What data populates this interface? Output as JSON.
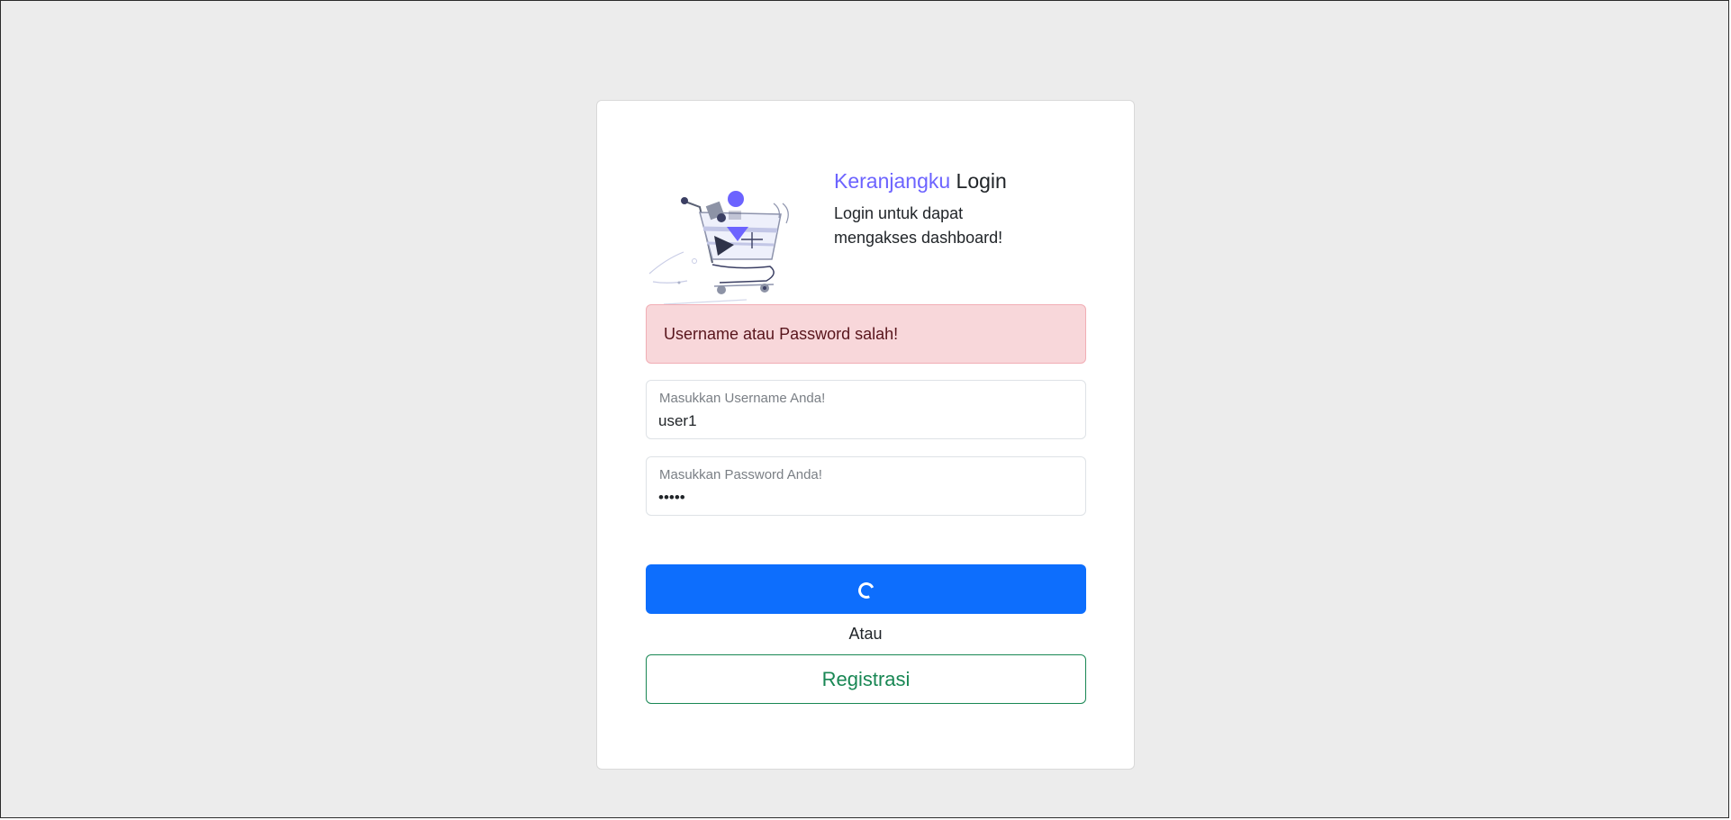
{
  "header": {
    "brand": "Keranjangku",
    "title_suffix": " Login",
    "subtitle": "Login untuk dapat mengakses dashboard!"
  },
  "alert": {
    "message": "Username atau Password salah!"
  },
  "form": {
    "username_label": "Masukkan Username Anda!",
    "username_value": "user1",
    "password_label": "Masukkan Password Anda!",
    "password_value": "•••••"
  },
  "actions": {
    "login_state": "loading",
    "or_label": "Atau",
    "register_label": "Registrasi"
  },
  "colors": {
    "brand": "#6c63ff",
    "primary": "#0d6efd",
    "success": "#198754",
    "danger_bg": "#f8d7da"
  },
  "icons": {
    "illustration": "shopping-cart-illustration",
    "spinner": "loading-spinner-icon"
  }
}
